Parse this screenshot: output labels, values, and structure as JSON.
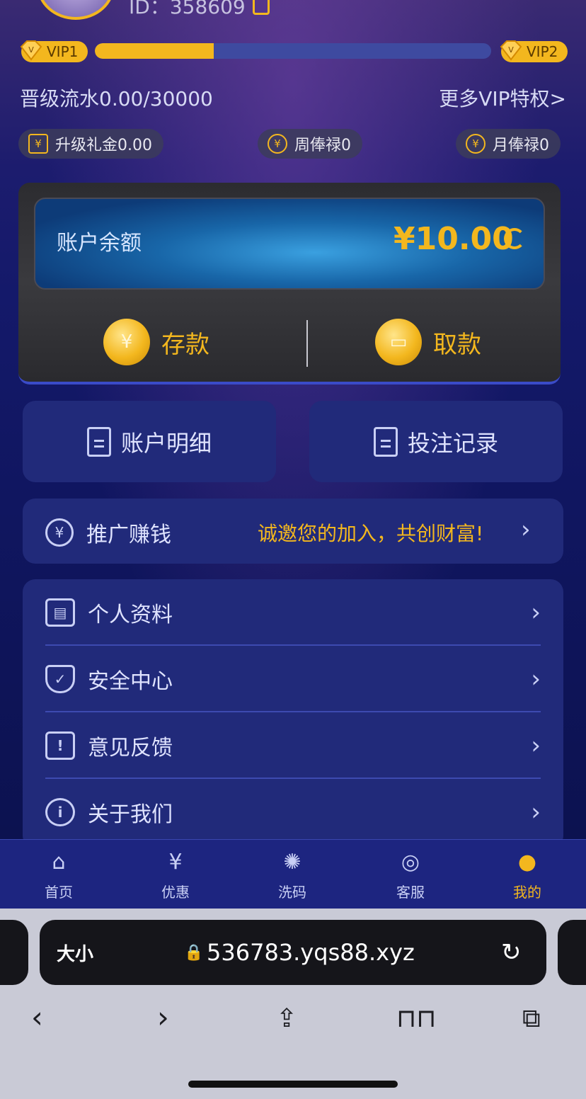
{
  "header": {
    "uid_text": "ID：358609"
  },
  "vip": {
    "current": "VIP1",
    "next": "VIP2",
    "progress_fraction": 0.3,
    "turnover_text": "晋级流水0.00/30000",
    "more_link": "更多VIP特权>"
  },
  "rewards": [
    {
      "label": "升级礼金0.00",
      "icon": "diamond-yen-icon"
    },
    {
      "label": "周俸禄0",
      "icon": "coin-yen-icon"
    },
    {
      "label": "月俸禄0",
      "icon": "coin-yen-icon"
    }
  ],
  "wallet": {
    "balance_label": "账户余额",
    "balance_value": "¥10.00",
    "deposit_label": "存款",
    "withdraw_label": "取款"
  },
  "quick": {
    "account_detail": "账户明细",
    "bet_record": "投注记录"
  },
  "promo": {
    "label": "推广赚钱",
    "slogan": "诚邀您的加入，共创财富!"
  },
  "menu": [
    {
      "label": "个人资料",
      "icon": "id-card-icon"
    },
    {
      "label": "安全中心",
      "icon": "shield-check-icon"
    },
    {
      "label": "意见反馈",
      "icon": "feedback-icon"
    },
    {
      "label": "关于我们",
      "icon": "info-icon"
    }
  ],
  "tabs": [
    {
      "label": "首页",
      "icon": "home-icon"
    },
    {
      "label": "优惠",
      "icon": "ticket-icon"
    },
    {
      "label": "洗码",
      "icon": "chip-icon"
    },
    {
      "label": "客服",
      "icon": "headset-icon"
    },
    {
      "label": "我的",
      "icon": "user-icon",
      "active": true
    }
  ],
  "browser": {
    "text_size": "大小",
    "url": "536783.yqs88.xyz"
  },
  "colors": {
    "accent": "#f3b71e",
    "card": "#212a7a",
    "tabbar": "#1d2580"
  }
}
